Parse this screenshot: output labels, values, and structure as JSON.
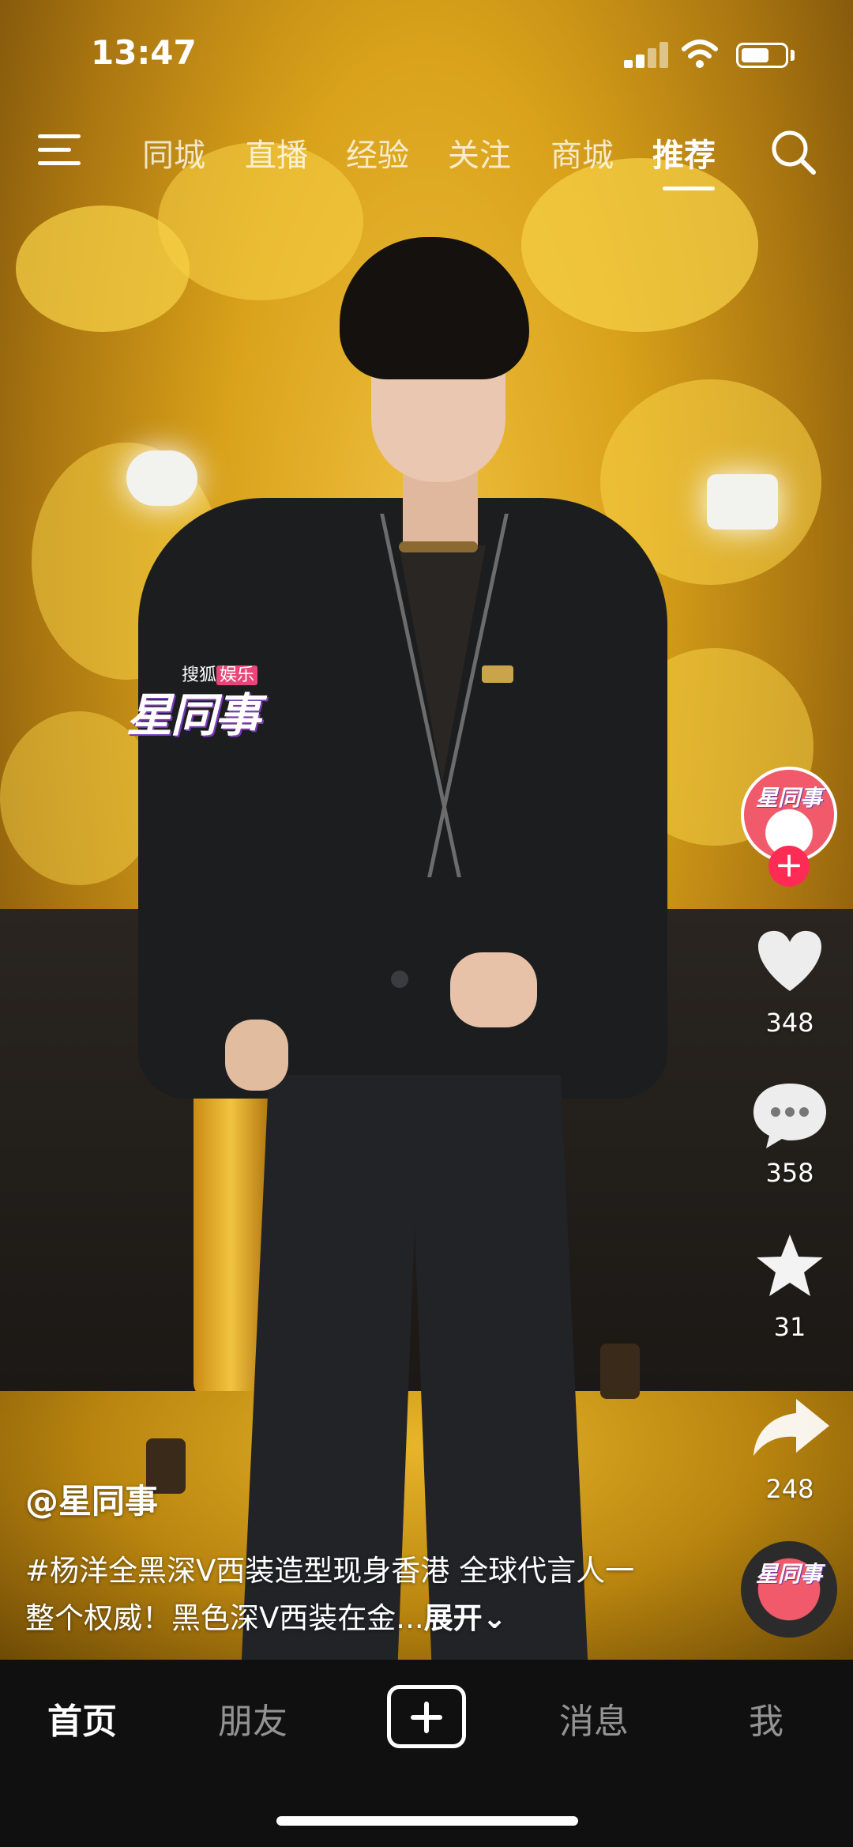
{
  "status_bar": {
    "time": "13:47"
  },
  "top_nav": {
    "tabs": [
      "同城",
      "直播",
      "经验",
      "关注",
      "商城",
      "推荐"
    ],
    "active_tab": "推荐"
  },
  "watermark": {
    "line1_a": "搜狐",
    "line1_b": "娱乐",
    "main": "星同事"
  },
  "rail": {
    "avatar_text": "星同事",
    "likes": "348",
    "comments": "358",
    "favorites": "31",
    "shares": "248"
  },
  "caption": {
    "author": "@星同事",
    "text": "#杨洋全黑深V西装造型现身香港 全球代言人一整个权威！黑色深V西装在金...",
    "expand": "展开"
  },
  "bottom_nav": {
    "home": "首页",
    "friends": "朋友",
    "messages": "消息",
    "me": "我"
  }
}
